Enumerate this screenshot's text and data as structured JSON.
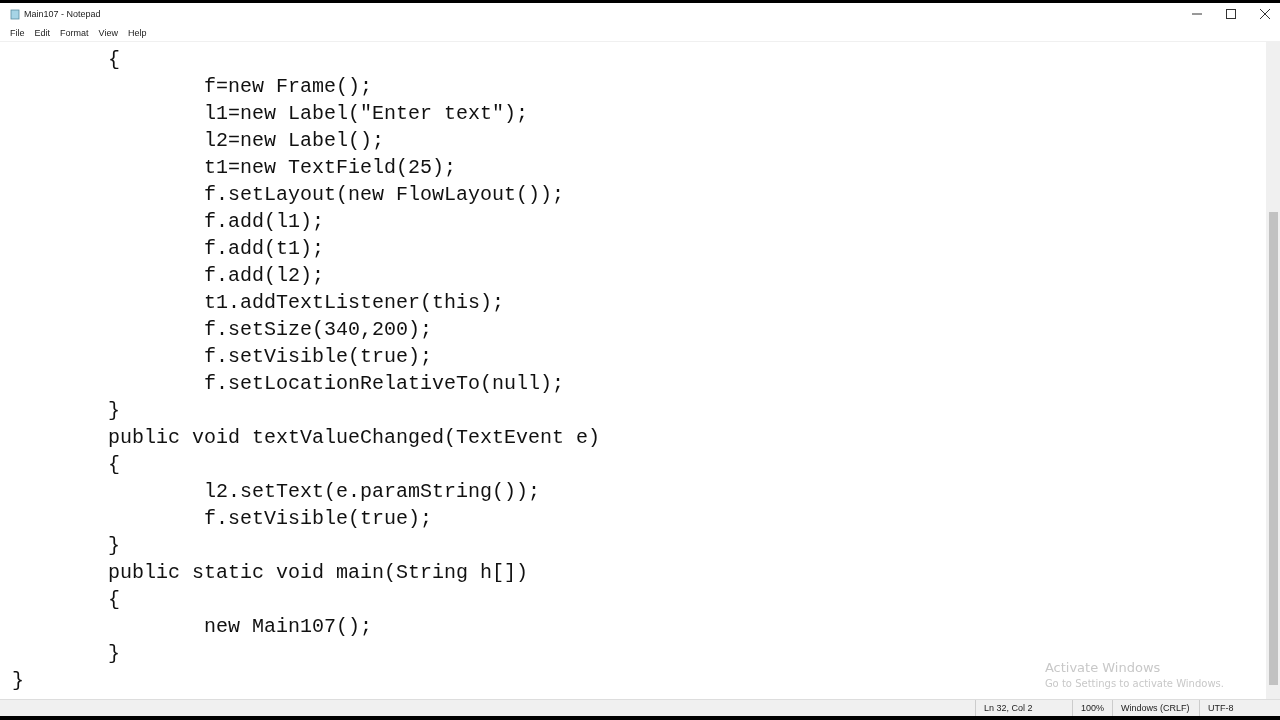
{
  "window": {
    "title": "Main107 - Notepad"
  },
  "menu": [
    "File",
    "Edit",
    "Format",
    "View",
    "Help"
  ],
  "editor": {
    "lines": [
      "\t{",
      "\t\tf=new Frame();",
      "\t\tl1=new Label(\"Enter text\");",
      "\t\tl2=new Label();",
      "\t\tt1=new TextField(25);",
      "\t\tf.setLayout(new FlowLayout());",
      "\t\tf.add(l1);",
      "\t\tf.add(t1);",
      "\t\tf.add(l2);",
      "\t\tt1.addTextListener(this);",
      "\t\tf.setSize(340,200);",
      "\t\tf.setVisible(true);",
      "\t\tf.setLocationRelativeTo(null);",
      "\t}",
      "\tpublic void textValueChanged(TextEvent e)",
      "\t{",
      "\t\tl2.setText(e.paramString());",
      "\t\tf.setVisible(true);",
      "\t}",
      "\tpublic static void main(String h[])",
      "\t{",
      "\t\tnew Main107();",
      "\t}",
      "}"
    ]
  },
  "activation_notice": {
    "title": "Activate Windows",
    "message": "Go to Settings to activate Windows."
  },
  "status_bar": [
    "Ln 32, Col 2",
    "100%",
    "Windows (CRLF)",
    "UTF-8"
  ]
}
